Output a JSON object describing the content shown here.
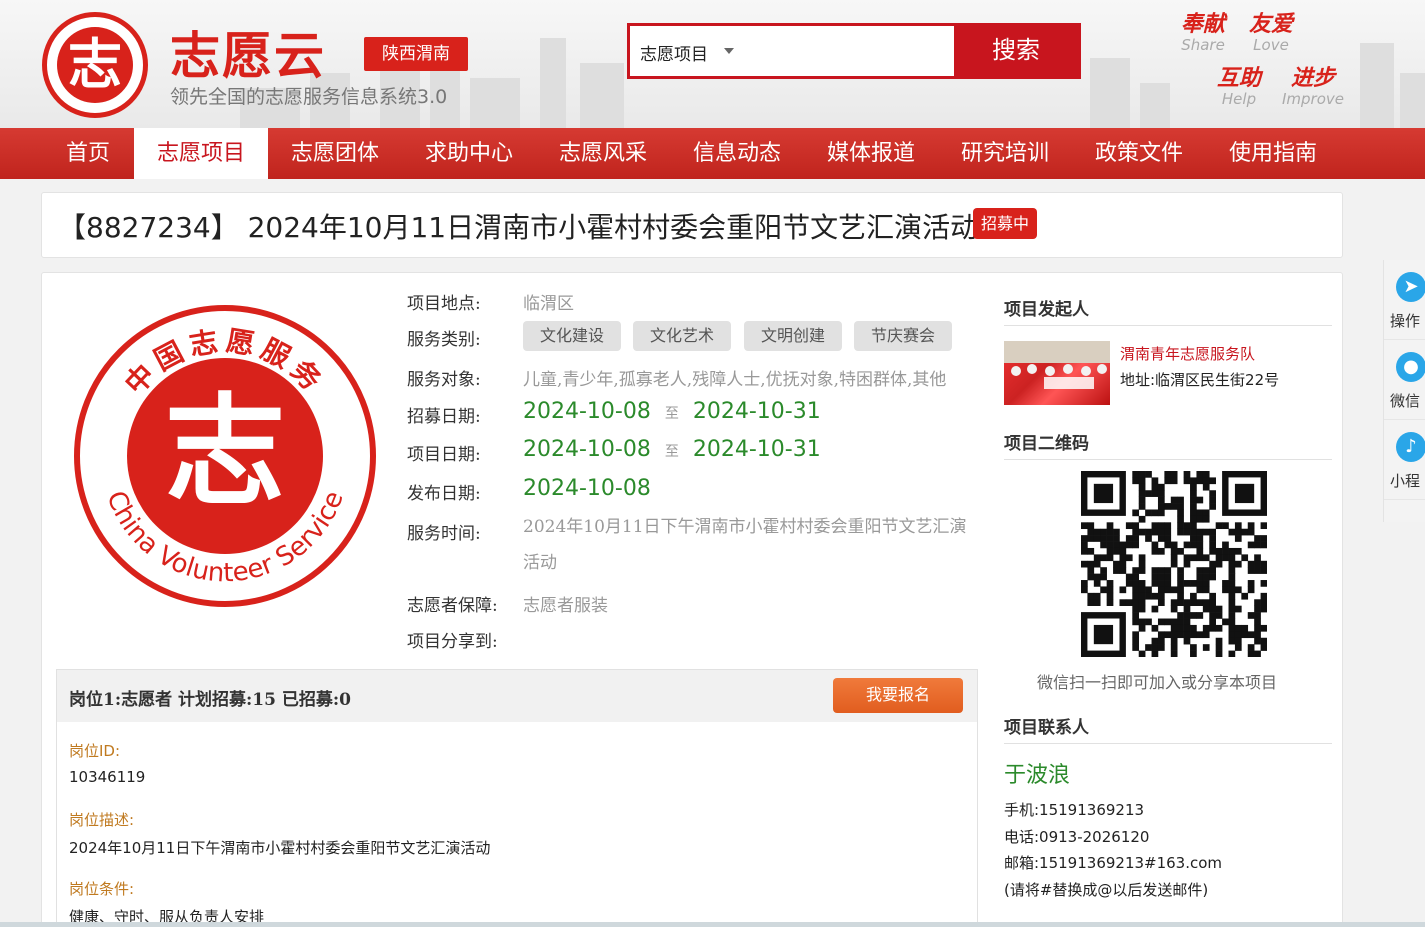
{
  "header": {
    "site_title": "志愿云",
    "site_subtitle": "领先全国的志愿服务信息系统3.0",
    "logo_char": "志",
    "region": "陕西渭南",
    "search": {
      "selected": "志愿项目",
      "value": "",
      "button": "搜索"
    },
    "values": [
      {
        "cn": "奉献",
        "en": "Share"
      },
      {
        "cn": "友爱",
        "en": "Love"
      },
      {
        "cn": "互助",
        "en": "Help"
      },
      {
        "cn": "进步",
        "en": "Improve"
      }
    ]
  },
  "nav": [
    "首页",
    "志愿项目",
    "志愿团体",
    "求助中心",
    "志愿风采",
    "信息动态",
    "媒体报道",
    "研究培训",
    "政策文件",
    "使用指南"
  ],
  "nav_active": "志愿项目",
  "project": {
    "title": "【8827234】 2024年10月11日渭南市小霍村村委会重阳节文艺汇演活动",
    "status": "招募中",
    "logo_text_top": "中国志愿服务",
    "logo_text_bottom": "China Volunteer Service",
    "logo_char": "志",
    "fields": {
      "location_label": "项目地点:",
      "location": "临渭区",
      "category_label": "服务类别:",
      "categories": [
        "文化建设",
        "文化艺术",
        "文明创建",
        "节庆赛会"
      ],
      "target_label": "服务对象:",
      "targets": "儿童,青少年,孤寡老人,残障人士,优抚对象,特困群体,其他",
      "recruit_label": "招募日期:",
      "recruit_start": "2024-10-08",
      "recruit_end": "2024-10-31",
      "project_label": "项目日期:",
      "project_start": "2024-10-08",
      "project_end": "2024-10-31",
      "publish_label": "发布日期:",
      "publish": "2024-10-08",
      "service_time_label": "服务时间:",
      "service_time": "2024年10月11日下午渭南市小霍村村委会重阳节文艺汇演活动",
      "guarantee_label": "志愿者保障:",
      "guarantee": "志愿者服装",
      "share_label": "项目分享到:",
      "to_text": "至"
    }
  },
  "position": {
    "header": "岗位1:志愿者   计划招募:15   已招募:0",
    "signup": "我要报名",
    "id_label": "岗位ID:",
    "id": "10346119",
    "desc_label": "岗位描述:",
    "desc": "2024年10月11日下午渭南市小霍村村委会重阳节文艺汇演活动",
    "cond_label": "岗位条件:",
    "cond": "健康、守时、服从负责人安排"
  },
  "sidebar": {
    "initiator_title": "项目发起人",
    "org_name": "渭南青年志愿服务队",
    "org_address": "地址:临渭区民生街22号",
    "qr_title": "项目二维码",
    "qr_caption": "微信扫一扫即可加入或分享本项目",
    "contact_title": "项目联系人",
    "contact_name": "于波浪",
    "phone": "手机:15191369213",
    "tel": "电话:0913-2026120",
    "email": "邮箱:15191369213#163.com",
    "email_note": "(请将#替换成@以后发送邮件)"
  },
  "float_toolbar": [
    {
      "label": "操作",
      "icon": "paper-plane-icon"
    },
    {
      "label": "微信",
      "icon": "wechat-icon"
    },
    {
      "label": "小程",
      "icon": "mini-program-icon"
    }
  ],
  "colors": {
    "brand_red": "#d8221b",
    "date_green": "#2b8a2b",
    "signup_orange": "#e86a2a"
  }
}
